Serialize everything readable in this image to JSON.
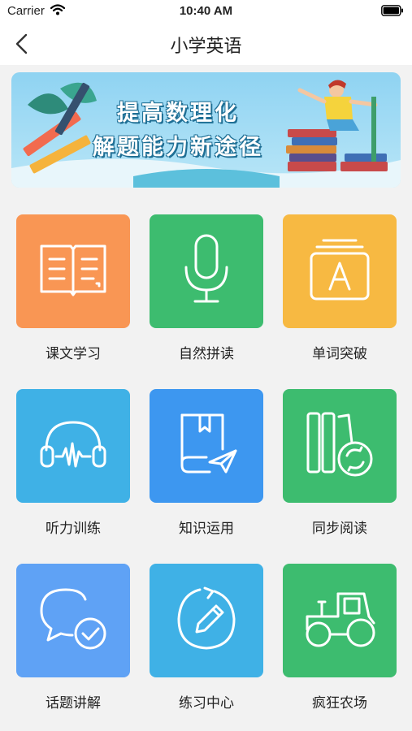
{
  "status_bar": {
    "carrier": "Carrier",
    "time": "10:40 AM"
  },
  "nav": {
    "title": "小学英语",
    "back_icon": "chevron-left-icon"
  },
  "banner": {
    "line1": "提高数理化",
    "line2": "解题能力新途径"
  },
  "tiles": [
    {
      "label": "课文学习",
      "color": "#f99654",
      "icon": "open-book-icon"
    },
    {
      "label": "自然拼读",
      "color": "#3dbc6f",
      "icon": "microphone-icon"
    },
    {
      "label": "单词突破",
      "color": "#f7b942",
      "icon": "letter-card-icon"
    },
    {
      "label": "听力训练",
      "color": "#3fb1e6",
      "icon": "headphones-icon"
    },
    {
      "label": "知识运用",
      "color": "#3d97f0",
      "icon": "book-send-icon"
    },
    {
      "label": "同步阅读",
      "color": "#3dbc6f",
      "icon": "books-sync-icon"
    },
    {
      "label": "话题讲解",
      "color": "#5fa2f5",
      "icon": "chat-check-icon"
    },
    {
      "label": "练习中心",
      "color": "#3fb1e6",
      "icon": "pencil-circle-icon"
    },
    {
      "label": "疯狂农场",
      "color": "#3dbc6f",
      "icon": "tractor-icon"
    }
  ]
}
